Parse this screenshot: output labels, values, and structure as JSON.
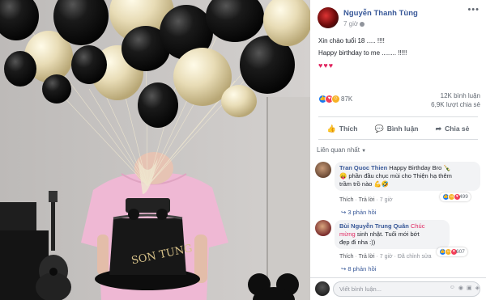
{
  "post": {
    "author": "Nguyễn Thanh Tùng",
    "time": "7 giờ",
    "line1": "Xin chào tuổi 18 ..... !!!!",
    "line2": "Happy birthday to me ........ !!!!!",
    "hearts": "♥♥♥"
  },
  "stats": {
    "reactions": "87K",
    "comments": "12K bình luận",
    "shares": "6,9K lượt chia sẻ"
  },
  "actions": {
    "like": "Thích",
    "comment": "Bình luận",
    "share": "Chia sẻ"
  },
  "sort_label": "Liên quan nhất",
  "comments": [
    {
      "name": "Tran Quoc Thien",
      "text1": "Happy Birthday Bro 🍾",
      "text2": "😛 phần đầu chục mùi cho Thiện hạ thêm",
      "text3": "trầm trồ nào 💪🤣",
      "like": "Thích",
      "reply": "Trả lời",
      "time": "7 giờ",
      "reactions": "499",
      "replies": "3 phản hồi"
    },
    {
      "name": "Bùi Nguyễn Trung Quân",
      "text1_highlight": "Chúc",
      "text2_highlight": "mừng",
      "text2": "sinh nhật. Tuổi mới bớt",
      "text3": "đẹp đi nha :))",
      "like": "Thích",
      "reply": "Trả lời",
      "time": "7 giờ",
      "edited": "Đã chỉnh sửa",
      "reactions": "607",
      "replies": "8 phản hồi"
    }
  ],
  "composer": {
    "placeholder": "Viết bình luận..."
  },
  "icons": {
    "like": "thumbs-up-icon",
    "comment": "comment-icon",
    "share": "share-icon",
    "more": "more-dots-icon",
    "camera": "camera-icon",
    "gif": "gif-icon",
    "sticker": "sticker-icon",
    "emoji": "emoji-icon"
  },
  "colors": {
    "accent": "#385898",
    "like_blue": "#1877f2",
    "love_red": "#f33e58",
    "haha_yellow": "#f7b125"
  }
}
